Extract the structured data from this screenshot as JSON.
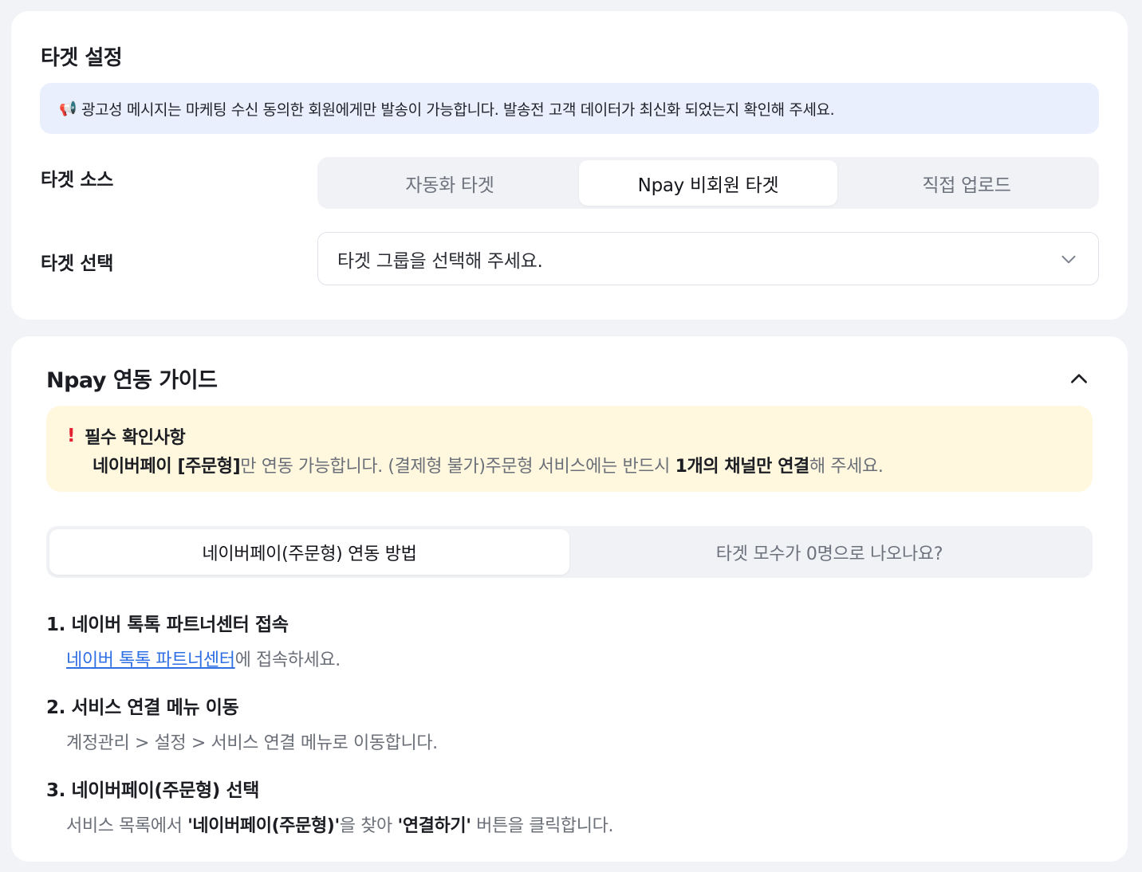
{
  "target_settings": {
    "title": "타겟 설정",
    "notice": {
      "icon": "megaphone-icon",
      "text": "광고성 메시지는 마케팅 수신 동의한 회원에게만 발송이 가능합니다. 발송전 고객 데이터가 최신화 되었는지 확인해 주세요."
    },
    "source_label": "타겟 소스",
    "source_options": [
      {
        "label": "자동화 타겟",
        "active": false
      },
      {
        "label": "Npay 비회원 타겟",
        "active": true
      },
      {
        "label": "직접 업로드",
        "active": false
      }
    ],
    "select_label": "타겟 선택",
    "select_placeholder": "타겟 그룹을 선택해 주세요."
  },
  "npay_guide": {
    "title": "Npay 연동 가이드",
    "expanded": true,
    "warning": {
      "icon": "exclamation-icon",
      "title": "필수 확인사항",
      "part1": "네이버페이 [주문형]",
      "part2": "만 연동 가능합니다. (결제형 불가)주문형 서비스에는 반드시 ",
      "part3": "1개의 채널만 연결",
      "part4": "해 주세요."
    },
    "tabs": [
      {
        "label": "네이버페이(주문형) 연동 방법",
        "active": true
      },
      {
        "label": "타겟 모수가 0명으로 나오나요?",
        "active": false
      }
    ],
    "steps": [
      {
        "title": "1. 네이버 톡톡 파트너센터 접속",
        "link_text": "네이버 톡톡 파트너센터",
        "desc_rest": "에 접속하세요."
      },
      {
        "title": "2. 서비스 연결 메뉴 이동",
        "desc": "계정관리 > 설정 > 서비스 연결 메뉴로 이동합니다."
      },
      {
        "title": "3. 네이버페이(주문형) 선택",
        "desc_a": "서비스 목록에서 ",
        "desc_b": "'네이버페이(주문형)'",
        "desc_c": "을 찾아 ",
        "desc_d": "'연결하기'",
        "desc_e": " 버튼을 클릭합니다."
      }
    ]
  },
  "colors": {
    "background": "#f2f3f7",
    "notice_bg": "#e9effd",
    "warning_bg": "#fff8df",
    "warning_accent": "#e5202f",
    "link": "#2f6fe4"
  }
}
